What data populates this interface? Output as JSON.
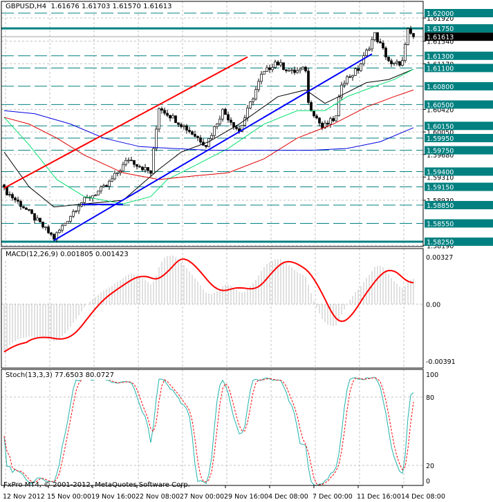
{
  "header": {
    "symbol": "GBPUSD,H4",
    "open": "1.61676",
    "high": "1.61703",
    "low": "1.61570",
    "close": "1.61613"
  },
  "macd_label": {
    "name": "MACD(12,26,9)",
    "main": "0.001805",
    "signal": "0.001423"
  },
  "stoch_label": {
    "name": "Stoch(13,3,3)",
    "main": "77.6503",
    "signal": "80.0727"
  },
  "copyright": "FxPro MT4, © 2001-2012, MetaQuotes Software Corp.",
  "colors": {
    "level": "#008080",
    "ma_fast": "#000000",
    "ma_green": "#00e070",
    "ma_red": "#e00000",
    "ma_blue": "#0000e0",
    "trend_red": "#ff0000",
    "trend_blue": "#0000ff",
    "macd_hist": "#c0c0c0",
    "macd_signal": "#ff0000",
    "stoch_main": "#20b2aa",
    "stoch_signal": "#ff0000"
  },
  "chart_data": {
    "type": "candlestick",
    "symbol": "GBPUSD",
    "timeframe": "H4",
    "price_range": [
      1.5819,
      1.6212
    ],
    "current_price": "1.61613",
    "grid_labels": [
      "1.61920",
      "1.61540",
      "1.61170",
      "1.60420",
      "1.60050",
      "1.59680",
      "1.59310",
      "1.58930",
      "1.58190"
    ],
    "levels": [
      {
        "price": "1.62000",
        "style": "dashed"
      },
      {
        "price": "1.61750",
        "style": "solid"
      },
      {
        "price": "1.61300",
        "style": "dashed"
      },
      {
        "price": "1.61100",
        "style": "dashed"
      },
      {
        "price": "1.60800",
        "style": "dashed"
      },
      {
        "price": "1.60500",
        "style": "dashed"
      },
      {
        "price": "1.60150",
        "style": "dashed"
      },
      {
        "price": "1.59950",
        "style": "dashed"
      },
      {
        "price": "1.59750",
        "style": "dashed"
      },
      {
        "price": "1.59400",
        "style": "dashed"
      },
      {
        "price": "1.59150",
        "style": "dashed"
      },
      {
        "price": "1.58850",
        "style": "dashed"
      },
      {
        "price": "1.58550",
        "style": "dashed"
      },
      {
        "price": "1.58250",
        "style": "solid"
      }
    ],
    "bars": 150,
    "close_anchors": [
      [
        0,
        1.591
      ],
      [
        7,
        1.5882
      ],
      [
        18,
        1.5831
      ],
      [
        27,
        1.5887
      ],
      [
        37,
        1.5916
      ],
      [
        45,
        1.5961
      ],
      [
        53,
        1.5938
      ],
      [
        56,
        1.6046
      ],
      [
        64,
        1.6018
      ],
      [
        73,
        1.5984
      ],
      [
        79,
        1.604
      ],
      [
        85,
        1.6006
      ],
      [
        93,
        1.6097
      ],
      [
        98,
        1.612
      ],
      [
        104,
        1.6103
      ],
      [
        109,
        1.6108
      ],
      [
        110,
        1.6052
      ],
      [
        115,
        1.6012
      ],
      [
        120,
        1.6029
      ],
      [
        122,
        1.6086
      ],
      [
        128,
        1.6108
      ],
      [
        134,
        1.6165
      ],
      [
        140,
        1.6114
      ],
      [
        144,
        1.612
      ],
      [
        146,
        1.617
      ],
      [
        148,
        1.61613
      ]
    ],
    "moving_averages": [
      {
        "name": "fast",
        "color_key": "ma_fast",
        "points": [
          [
            0,
            1.5972
          ],
          [
            9,
            1.5915
          ],
          [
            18,
            1.5882
          ],
          [
            29,
            1.5887
          ],
          [
            43,
            1.5893
          ],
          [
            56,
            1.5944
          ],
          [
            64,
            1.5972
          ],
          [
            74,
            1.5989
          ],
          [
            85,
            1.6018
          ],
          [
            99,
            1.6063
          ],
          [
            109,
            1.6074
          ],
          [
            116,
            1.6052
          ],
          [
            121,
            1.6063
          ],
          [
            131,
            1.6086
          ],
          [
            139,
            1.6091
          ],
          [
            148,
            1.6108
          ]
        ]
      },
      {
        "name": "green",
        "color_key": "ma_green",
        "points": [
          [
            0,
            1.6029
          ],
          [
            9,
            1.5984
          ],
          [
            19,
            1.5927
          ],
          [
            29,
            1.5899
          ],
          [
            43,
            1.5887
          ],
          [
            53,
            1.5899
          ],
          [
            59,
            1.5927
          ],
          [
            69,
            1.595
          ],
          [
            81,
            1.5978
          ],
          [
            94,
            1.6018
          ],
          [
            106,
            1.604
          ],
          [
            116,
            1.604
          ],
          [
            124,
            1.6063
          ],
          [
            134,
            1.608
          ],
          [
            141,
            1.6091
          ],
          [
            148,
            1.6108
          ]
        ]
      },
      {
        "name": "red",
        "color_key": "ma_red",
        "points": [
          [
            0,
            1.6029
          ],
          [
            9,
            1.6018
          ],
          [
            19,
            1.5995
          ],
          [
            29,
            1.5967
          ],
          [
            43,
            1.5938
          ],
          [
            56,
            1.5927
          ],
          [
            69,
            1.5933
          ],
          [
            81,
            1.5938
          ],
          [
            94,
            1.5961
          ],
          [
            106,
            1.5995
          ],
          [
            119,
            1.6018
          ],
          [
            131,
            1.6046
          ],
          [
            141,
            1.6063
          ],
          [
            148,
            1.6074
          ]
        ]
      },
      {
        "name": "blue",
        "color_key": "ma_blue",
        "points": [
          [
            0,
            1.604
          ],
          [
            11,
            1.6035
          ],
          [
            24,
            1.6018
          ],
          [
            36,
            1.5995
          ],
          [
            49,
            1.5981
          ],
          [
            61,
            1.5978
          ],
          [
            74,
            1.5975
          ],
          [
            86,
            1.5975
          ],
          [
            99,
            1.5975
          ],
          [
            111,
            1.5975
          ],
          [
            124,
            1.5978
          ],
          [
            136,
            1.5989
          ],
          [
            148,
            1.6012
          ]
        ]
      }
    ],
    "trendlines": [
      {
        "name": "red-channel-line",
        "color_key": "trend_red",
        "from": [
          0,
          1.5913
        ],
        "to": [
          88,
          1.6128
        ]
      },
      {
        "name": "blue-support-line",
        "color_key": "trend_blue",
        "from": [
          18,
          1.5827
        ],
        "to": [
          133,
          1.6133
        ]
      },
      {
        "name": "blue-horizontal-line",
        "color_key": "trend_blue",
        "from": [
          28,
          1.5886
        ],
        "to": [
          43,
          1.5886
        ]
      }
    ],
    "time_labels": [
      {
        "bar": 0,
        "text": "12 Nov 2012"
      },
      {
        "bar": 16,
        "text": "15 Nov 00:00"
      },
      {
        "bar": 32,
        "text": "19 Nov 16:00"
      },
      {
        "bar": 48,
        "text": "22 Nov 08:00"
      },
      {
        "bar": 64,
        "text": "27 Nov 00:00"
      },
      {
        "bar": 80,
        "text": "29 Nov 16:00"
      },
      {
        "bar": 96,
        "text": "4 Dec 08:00"
      },
      {
        "bar": 112,
        "text": "7 Dec 00:00"
      },
      {
        "bar": 128,
        "text": "11 Dec 16:00"
      },
      {
        "bar": 144,
        "text": "14 Dec 08:00"
      }
    ],
    "macd": {
      "fast": 12,
      "slow": 26,
      "signal": 9,
      "range": [
        -0.00391,
        0.00327
      ],
      "axis_labels": [
        "0.00327",
        "0.00",
        "-0.00391"
      ],
      "seed_fast": 1.59,
      "seed_slow": 1.5935
    },
    "stochastic": {
      "k": 13,
      "d": 3,
      "slowing": 3,
      "range": [
        0,
        100
      ],
      "axis_labels": [
        "100",
        "80",
        "20",
        "0"
      ]
    }
  }
}
